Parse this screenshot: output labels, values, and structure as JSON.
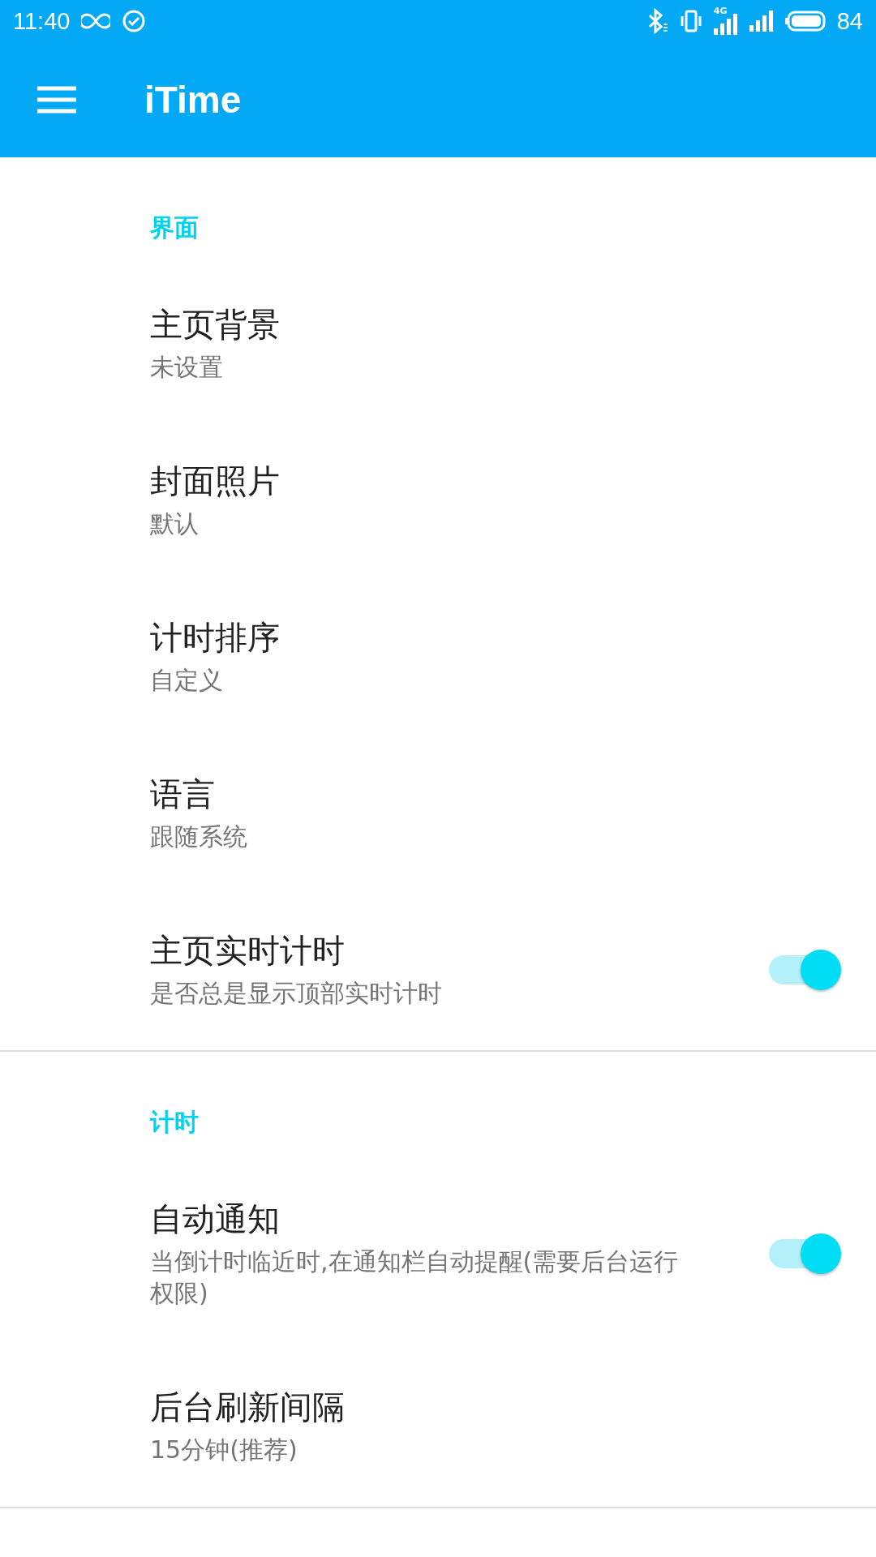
{
  "status_bar": {
    "time": "11:40",
    "network": "4G",
    "battery": "84"
  },
  "app_bar": {
    "title": "iTime"
  },
  "sections": [
    {
      "title": "界面",
      "items": [
        {
          "kind": "text",
          "title": "主页背景",
          "subtitle": "未设置"
        },
        {
          "kind": "text",
          "title": "封面照片",
          "subtitle": "默认"
        },
        {
          "kind": "text",
          "title": "计时排序",
          "subtitle": "自定义"
        },
        {
          "kind": "text",
          "title": "语言",
          "subtitle": "跟随系统"
        },
        {
          "kind": "switch",
          "title": "主页实时计时",
          "subtitle": "是否总是显示顶部实时计时",
          "on": true
        }
      ]
    },
    {
      "title": "计时",
      "items": [
        {
          "kind": "switch",
          "title": "自动通知",
          "subtitle": "当倒计时临近时,在通知栏自动提醒(需要后台运行权限)",
          "on": true
        },
        {
          "kind": "text",
          "title": "后台刷新间隔",
          "subtitle": "15分钟(推荐)"
        }
      ]
    }
  ]
}
